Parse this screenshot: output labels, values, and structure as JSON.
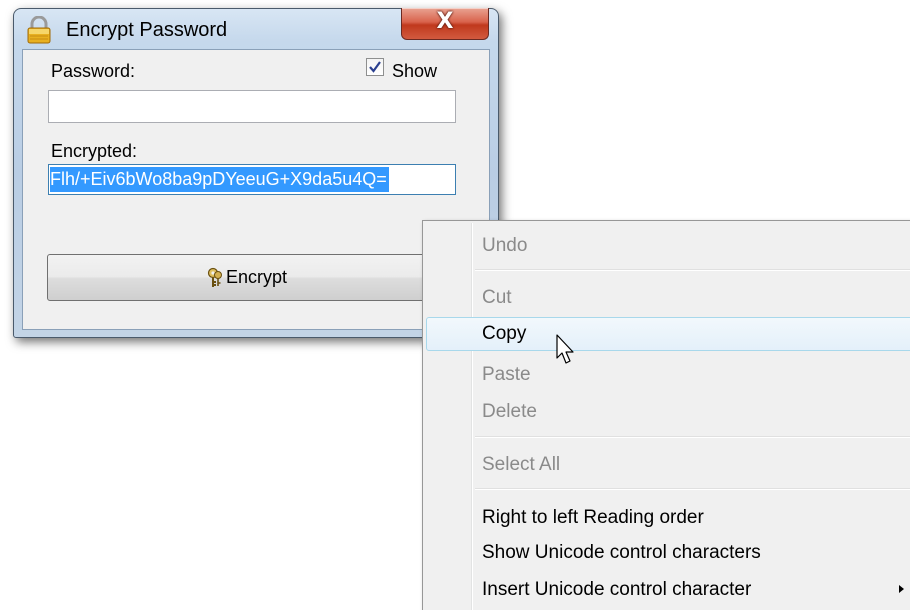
{
  "window": {
    "title": "Encrypt Password",
    "close_label": "X"
  },
  "form": {
    "password_label": "Password:",
    "show_label": "Show",
    "show_checked": true,
    "password_value": "",
    "encrypted_label": "Encrypted:",
    "encrypted_value": "Flh/+Eiv6bWo8ba9pDYeeuG+X9da5u4Q=",
    "encrypt_button_label": "Encrypt"
  },
  "context_menu": {
    "items": [
      {
        "label": "Undo",
        "enabled": false
      },
      {
        "label": "Cut",
        "enabled": false
      },
      {
        "label": "Copy",
        "enabled": true,
        "highlighted": true
      },
      {
        "label": "Paste",
        "enabled": false
      },
      {
        "label": "Delete",
        "enabled": false
      },
      {
        "label": "Select All",
        "enabled": false
      },
      {
        "label": "Right to left Reading order",
        "enabled": true
      },
      {
        "label": "Show Unicode control characters",
        "enabled": true
      },
      {
        "label": "Insert Unicode control character",
        "enabled": true,
        "has_submenu": true
      }
    ]
  },
  "icons": {
    "title": "padlock-icon",
    "button": "key-icon",
    "checkbox": "checkmark-icon",
    "submenu": "submenu-arrow-icon",
    "pointer": "mouse-pointer-icon"
  },
  "colors": {
    "selection": "#3399ff",
    "close_button": "#c0391d",
    "menu_hover_border": "#a8d8eb",
    "disabled_text": "#8a8a8a"
  }
}
